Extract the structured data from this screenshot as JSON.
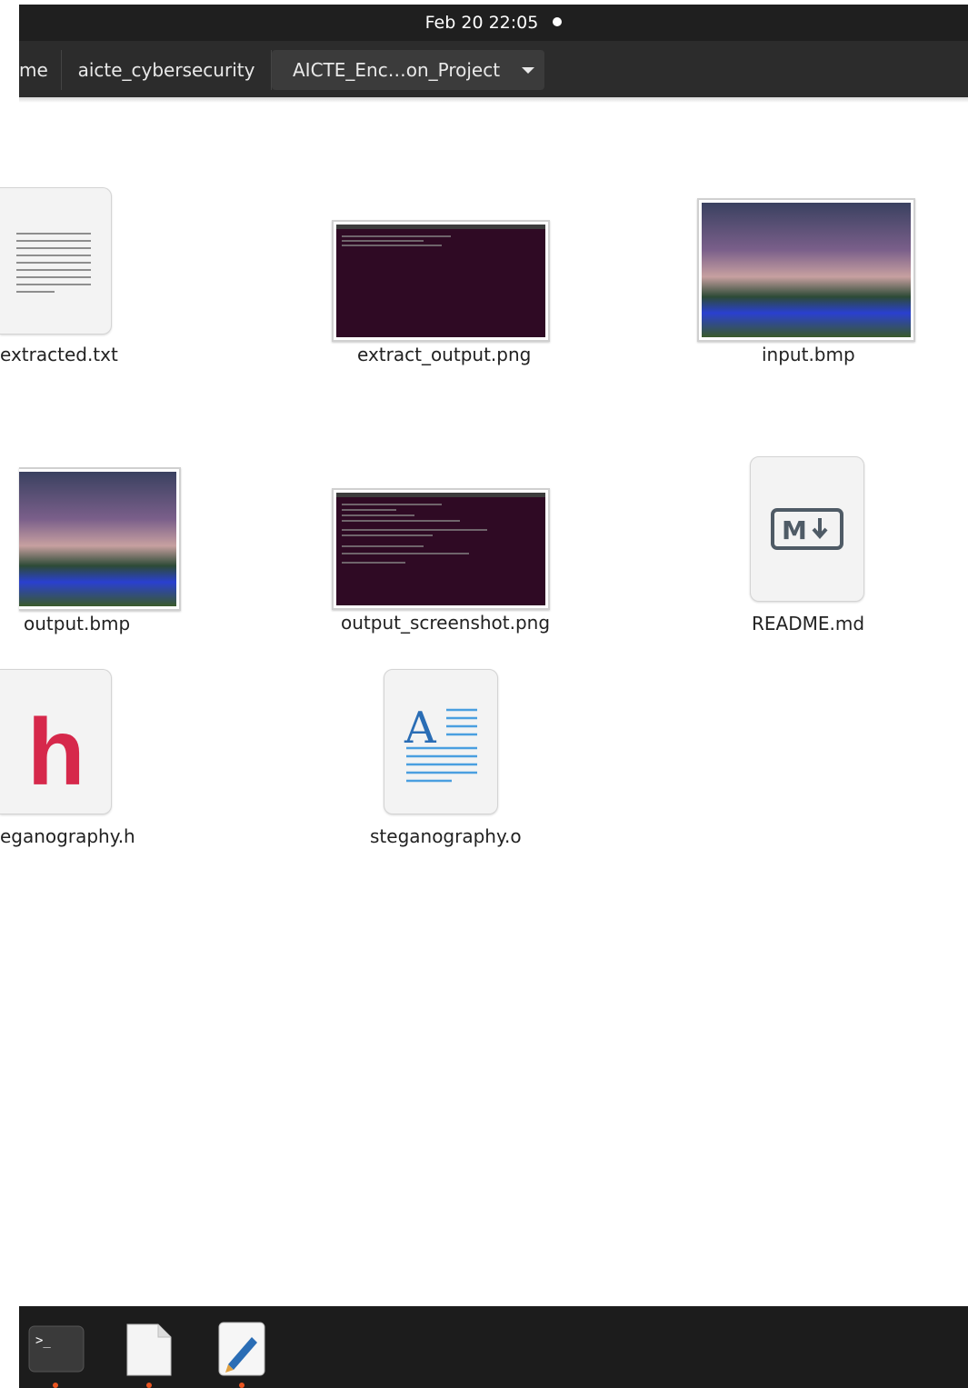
{
  "topbar": {
    "datetime": "Feb 20  22:05"
  },
  "pathbar": {
    "crumbs": [
      "me",
      "aicte_cybersecurity",
      "AICTE_Enc…on_Project"
    ]
  },
  "files": [
    {
      "name": "extracted.txt",
      "icon": "text-file-icon"
    },
    {
      "name": "extract_output.png",
      "icon": "terminal-screenshot-thumbnail"
    },
    {
      "name": "input.bmp",
      "icon": "landscape-thumbnail"
    },
    {
      "name": "output.bmp",
      "icon": "landscape-thumbnail"
    },
    {
      "name": "output_screenshot.png",
      "icon": "terminal-screenshot-thumbnail"
    },
    {
      "name": "README.md",
      "icon": "markdown-icon"
    },
    {
      "name": "eganography.h",
      "icon": "c-header-icon"
    },
    {
      "name": "steganography.o",
      "icon": "object-file-icon"
    }
  ],
  "dock": {
    "apps": [
      {
        "icon": "terminal-icon"
      },
      {
        "icon": "files-icon"
      },
      {
        "icon": "text-editor-icon"
      }
    ]
  },
  "colors": {
    "topbar": "#1f1f1f",
    "pathbar": "#2c2c2c",
    "dock": "#1c1c1c",
    "running-indicator": "#e95420",
    "header-h": "#d6284b"
  }
}
